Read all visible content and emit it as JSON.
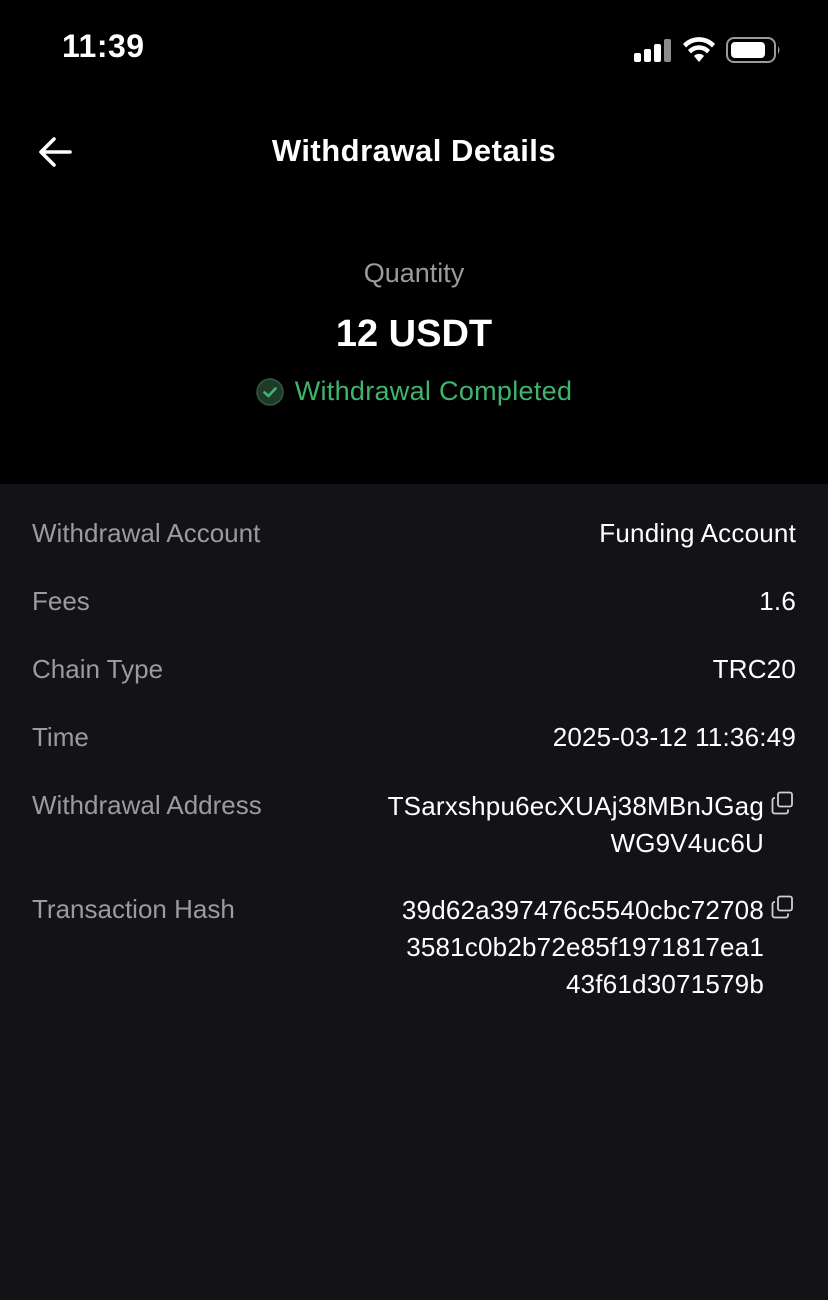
{
  "status_bar": {
    "time": "11:39"
  },
  "header": {
    "title": "Withdrawal Details"
  },
  "summary": {
    "quantity_label": "Quantity",
    "quantity_value": "12 USDT",
    "status_text": "Withdrawal Completed",
    "status_color": "#3fb46c"
  },
  "details": {
    "withdrawal_account": {
      "label": "Withdrawal Account",
      "value": "Funding Account"
    },
    "fees": {
      "label": "Fees",
      "value": "1.6"
    },
    "chain_type": {
      "label": "Chain Type",
      "value": "TRC20"
    },
    "time": {
      "label": "Time",
      "value": "2025-03-12 11:36:49"
    },
    "withdrawal_address": {
      "label": "Withdrawal Address",
      "lines": [
        "TSarxshpu6ecXUAj38MBnJGag",
        "WG9V4uc6U"
      ]
    },
    "transaction_hash": {
      "label": "Transaction Hash",
      "lines": [
        "39d62a397476c5540cbc72708",
        "3581c0b2b72e85f1971817ea1",
        "43f61d3071579b"
      ]
    }
  },
  "icons": {
    "back": "arrow-left-icon",
    "copy": "copy-icon",
    "check": "check-circle-icon"
  }
}
